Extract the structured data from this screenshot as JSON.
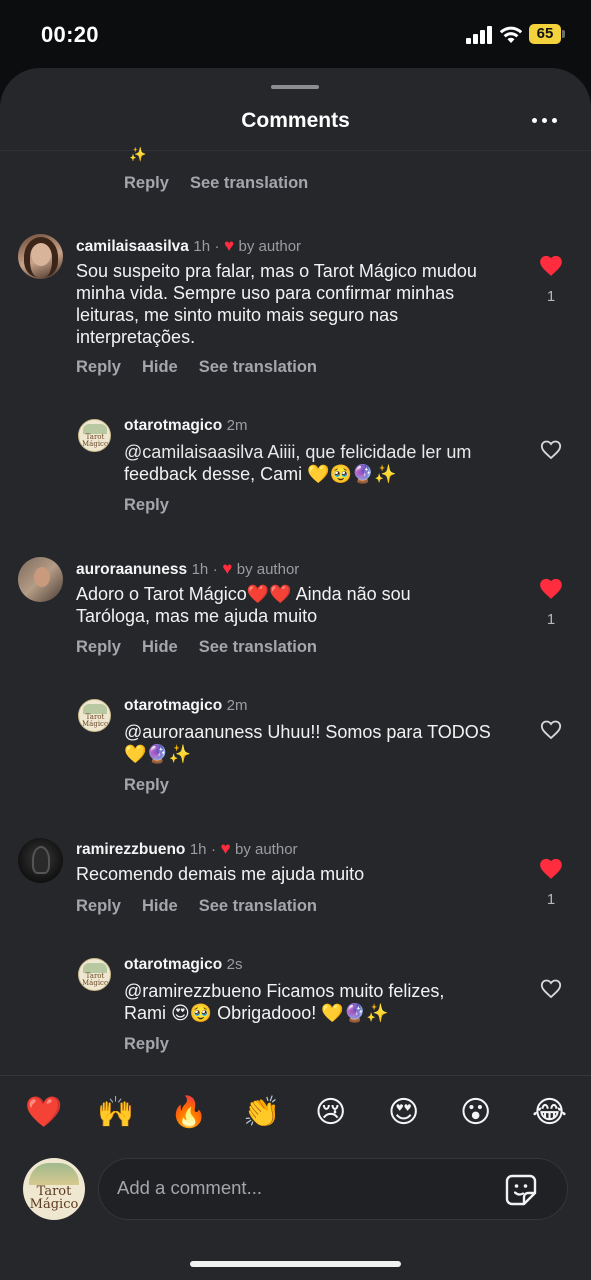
{
  "status_bar": {
    "time": "00:20",
    "battery": "65"
  },
  "header": {
    "title": "Comments"
  },
  "top_partial": {
    "emoji": "✨",
    "reply": "Reply",
    "see_translation": "See translation"
  },
  "comments": [
    {
      "username": "camilaisaasilva",
      "time": "1h",
      "dot": "·",
      "by_author": "by author",
      "lines": [
        "Sou suspeito pra falar, mas o Tarot Mágico mudou",
        "minha vida. Sempre uso para confirmar minhas",
        "leituras, me sinto muito mais seguro nas",
        "interpretações."
      ],
      "like_count": "1",
      "reply": "Reply",
      "hide": "Hide",
      "see_translation": "See translation",
      "reply_item": {
        "username": "otarotmagico",
        "time": "2m",
        "lines": [
          "@camilaisaasilva Aiiii, que felicidade ler um",
          "feedback desse, Cami 💛🥹🔮✨"
        ],
        "reply": "Reply"
      }
    },
    {
      "username": "auroraanuness",
      "time": "1h",
      "dot": "·",
      "by_author": "by author",
      "lines": [
        "Adoro o Tarot Mágico❤️❤️ Ainda não sou",
        "Taróloga, mas me ajuda muito"
      ],
      "like_count": "1",
      "reply": "Reply",
      "hide": "Hide",
      "see_translation": "See translation",
      "reply_item": {
        "username": "otarotmagico",
        "time": "2m",
        "lines": [
          "@auroraanuness Uhuu!! Somos para TODOS",
          "💛🔮✨"
        ],
        "reply": "Reply"
      }
    },
    {
      "username": "ramirezzbueno",
      "time": "1h",
      "dot": "·",
      "by_author": "by author",
      "lines": [
        "Recomendo demais me ajuda muito"
      ],
      "like_count": "1",
      "reply": "Reply",
      "hide": "Hide",
      "see_translation": "See translation",
      "reply_item": {
        "username": "otarotmagico",
        "time": "2s",
        "lines": [
          "@ramirezzbueno Ficamos muito felizes,",
          "Rami 😍🥹 Obrigadooo! 💛🔮✨"
        ],
        "reply": "Reply"
      }
    }
  ],
  "quick_emojis": [
    "❤️",
    "🙌",
    "🔥",
    "👏",
    "😢",
    "😍",
    "😮",
    "😂"
  ],
  "composer": {
    "placeholder": "Add a comment...",
    "avatar_text_1": "Tarot",
    "avatar_text_2": "Mágico"
  },
  "icons": {
    "heart_filled_color": "#ff2d3d",
    "heart_outline": "heart-outline-icon"
  }
}
